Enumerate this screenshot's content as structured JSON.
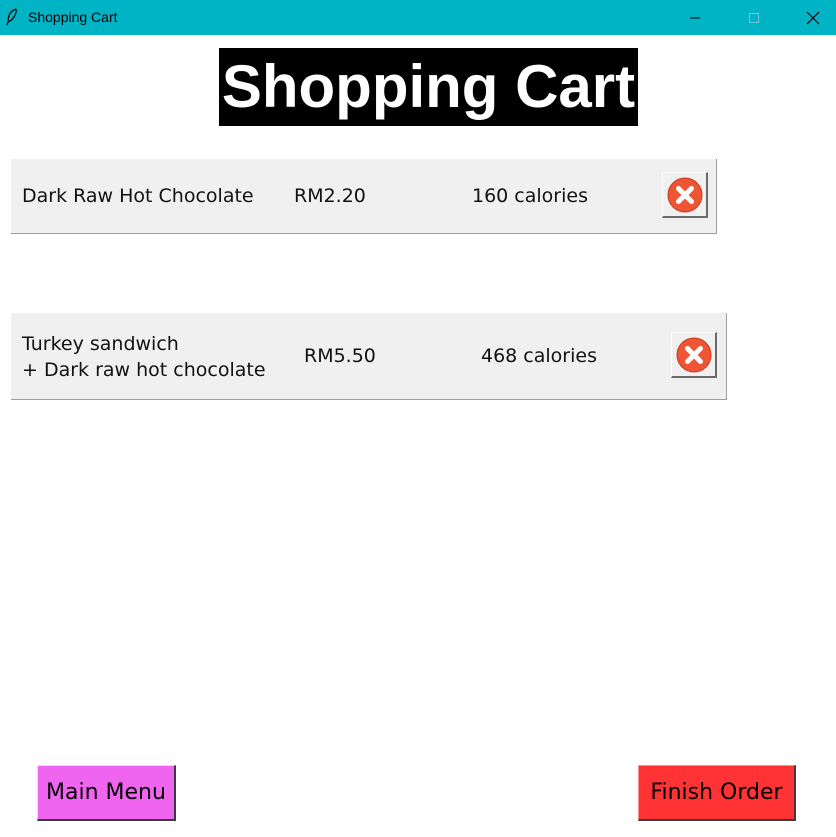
{
  "window": {
    "title": "Shopping Cart",
    "titlebar_color": "#00b4c6"
  },
  "heading": {
    "text": "Shopping Cart"
  },
  "cart": {
    "items": [
      {
        "name_lines": [
          "Dark Raw Hot Chocolate"
        ],
        "price": "RM2.20",
        "calories": "160 calories",
        "remove_icon": "remove-circle-x-icon"
      },
      {
        "name_lines": [
          "Turkey sandwich",
          "+ Dark raw hot chocolate"
        ],
        "price": "RM5.50",
        "calories": "468 calories",
        "remove_icon": "remove-circle-x-icon"
      }
    ]
  },
  "buttons": {
    "main_menu": {
      "label": "Main Menu",
      "color": "#f065f0"
    },
    "finish_order": {
      "label": "Finish Order",
      "color": "#ff3333"
    }
  },
  "colors": {
    "remove_icon": "#ee5535",
    "row_background": "#f0f0f0"
  }
}
